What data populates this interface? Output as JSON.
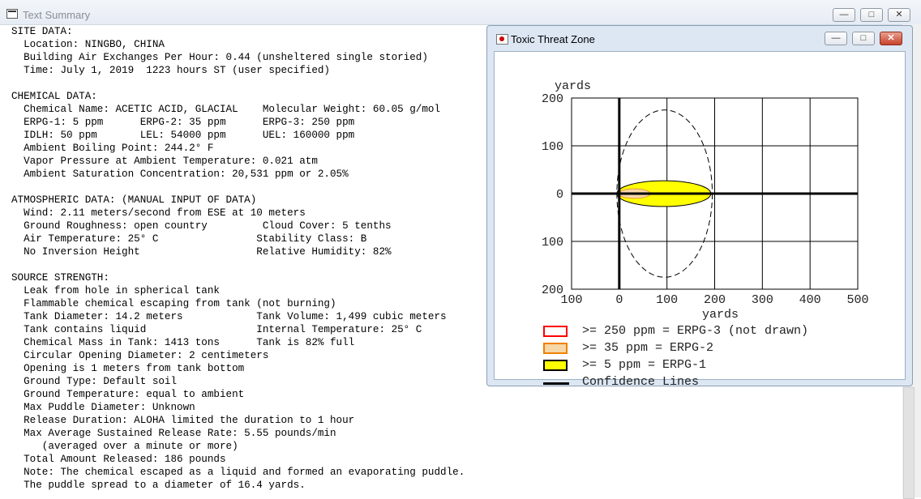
{
  "main_window": {
    "title": "Text Summary",
    "summary_lines": [
      "SITE DATA:",
      "  Location: NINGBO, CHINA",
      "  Building Air Exchanges Per Hour: 0.44 (unsheltered single storied)",
      "  Time: July 1, 2019  1223 hours ST (user specified)",
      "",
      "CHEMICAL DATA:",
      "  Chemical Name: ACETIC ACID, GLACIAL    Molecular Weight: 60.05 g/mol",
      "  ERPG-1: 5 ppm      ERPG-2: 35 ppm      ERPG-3: 250 ppm",
      "  IDLH: 50 ppm       LEL: 54000 ppm      UEL: 160000 ppm",
      "  Ambient Boiling Point: 244.2° F",
      "  Vapor Pressure at Ambient Temperature: 0.021 atm",
      "  Ambient Saturation Concentration: 20,531 ppm or 2.05%",
      "",
      "ATMOSPHERIC DATA: (MANUAL INPUT OF DATA)",
      "  Wind: 2.11 meters/second from ESE at 10 meters",
      "  Ground Roughness: open country         Cloud Cover: 5 tenths",
      "  Air Temperature: 25° C                Stability Class: B",
      "  No Inversion Height                   Relative Humidity: 82%",
      "",
      "SOURCE STRENGTH:",
      "  Leak from hole in spherical tank",
      "  Flammable chemical escaping from tank (not burning)",
      "  Tank Diameter: 14.2 meters            Tank Volume: 1,499 cubic meters",
      "  Tank contains liquid                  Internal Temperature: 25° C",
      "  Chemical Mass in Tank: 1413 tons      Tank is 82% full",
      "  Circular Opening Diameter: 2 centimeters",
      "  Opening is 1 meters from tank bottom",
      "  Ground Type: Default soil",
      "  Ground Temperature: equal to ambient",
      "  Max Puddle Diameter: Unknown",
      "  Release Duration: ALOHA limited the duration to 1 hour",
      "  Max Average Sustained Release Rate: 5.55 pounds/min",
      "     (averaged over a minute or more)",
      "  Total Amount Released: 186 pounds",
      "  Note: The chemical escaped as a liquid and formed an evaporating puddle.",
      "  The puddle spread to a diameter of 16.4 yards."
    ]
  },
  "threat_window": {
    "title": "Toxic Threat Zone",
    "legend": [
      {
        "label": ">= 250 ppm = ERPG-3 (not drawn)",
        "color": "#ff0000",
        "fill": "#ffffff"
      },
      {
        "label": ">= 35 ppm = ERPG-2",
        "color": "#f08000",
        "fill": "#f6d7a8"
      },
      {
        "label": ">= 5 ppm = ERPG-1",
        "color": "#000000",
        "fill": "#ffff00"
      },
      {
        "label": "Confidence Lines",
        "color": "#000000"
      }
    ]
  },
  "chart_data": {
    "type": "area",
    "xlabel": "yards",
    "ylabel": "yards",
    "xlim": [
      -100,
      500
    ],
    "ylim": [
      -200,
      200
    ],
    "x_ticks": [
      "100",
      "0",
      "100",
      "200",
      "300",
      "400",
      "500"
    ],
    "y_ticks": [
      "200",
      "100",
      "0",
      "100",
      "200"
    ],
    "grid": true,
    "series": [
      {
        "name": ">= 5 ppm = ERPG-1",
        "color": "#ffff00",
        "x_extent": [
          -5,
          192
        ],
        "half_width": 27
      },
      {
        "name": ">= 35 ppm = ERPG-2",
        "color": "#f6d7a8",
        "x_extent": [
          -2,
          65
        ],
        "half_width": 10
      },
      {
        "name": "Confidence Lines",
        "color": "#000000",
        "x_extent": [
          -5,
          195
        ],
        "half_width": 175
      }
    ]
  }
}
